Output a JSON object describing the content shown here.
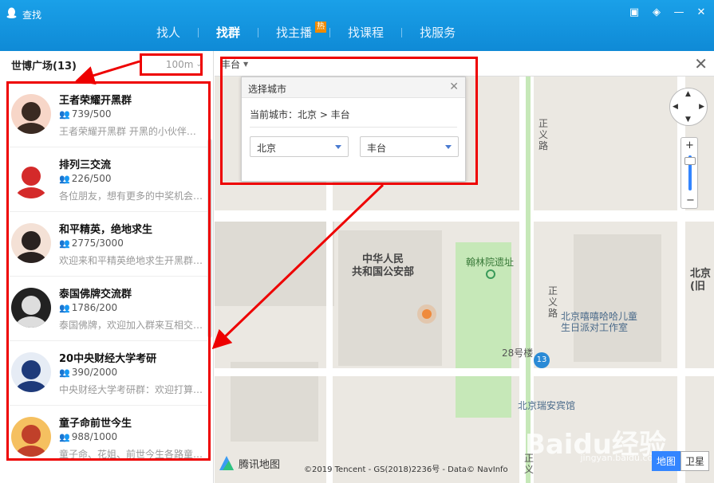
{
  "window": {
    "title": "查找",
    "tabs": [
      {
        "label": "找人"
      },
      {
        "label": "找群"
      },
      {
        "label": "找主播",
        "badge": "热"
      },
      {
        "label": "找课程"
      },
      {
        "label": "找服务"
      }
    ]
  },
  "left": {
    "place": "世博广场(13)",
    "distance": "100m",
    "groups": [
      {
        "name": "王者荣耀开黑群",
        "count": "739/500",
        "desc": "王者荣耀开黑群 开黑的小伙伴…"
      },
      {
        "name": "排列三交流",
        "count": "226/500",
        "desc": "各位朋友，想有更多的中奖机会…"
      },
      {
        "name": "和平精英，绝地求生",
        "count": "2775/3000",
        "desc": "欢迎来和平精英绝地求生开黑群…"
      },
      {
        "name": "泰国佛牌交流群",
        "count": "1786/200",
        "desc": "泰国佛牌，欢迎加入群来互相交…"
      },
      {
        "name": "20中央财经大学考研",
        "count": "390/2000",
        "desc": "中央财经大学考研群：欢迎打算…"
      },
      {
        "name": "童子命前世今生",
        "count": "988/1000",
        "desc": "童子命、花姐、前世今生各路童…"
      }
    ]
  },
  "map": {
    "city_select": "丰台",
    "popup": {
      "title": "选择城市",
      "current": "当前城市：北京 > 丰台",
      "province": "北京",
      "district": "丰台"
    },
    "labels": {
      "ministry": "中华人民\n共和国公安部",
      "hanlin": "翰林院遗址",
      "zhengyilu1": "正\n义\n路",
      "zhengyilu2": "正\n义\n路",
      "zhengyilu3": "正\n义",
      "studio": "北京嘻嘻哈哈儿童\n生日派对工作室",
      "bldg28": "28号楼",
      "hotel": "北京瑞安宾馆",
      "beijingside": "北京\n(旧",
      "route": "13"
    },
    "logo": "腾讯地图",
    "copyright": "©2019 Tencent - GS(2018)2236号 - Data© NavInfo",
    "types": [
      "地图",
      "卫星"
    ],
    "watermark": "Baidu经验",
    "watermark_sub": "jingyan.baidu.com"
  }
}
